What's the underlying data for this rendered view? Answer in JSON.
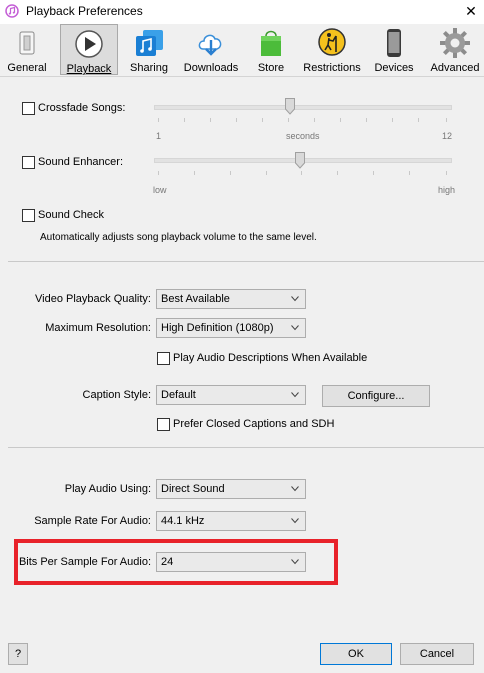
{
  "window": {
    "title": "Playback Preferences",
    "close_glyph": "✕"
  },
  "tabs": [
    {
      "label": "General",
      "icon": "general-switch-icon"
    },
    {
      "label": "Playback",
      "icon": "play-icon",
      "selected": true
    },
    {
      "label": "Sharing",
      "icon": "sharing-music-icon"
    },
    {
      "label": "Downloads",
      "icon": "download-cloud-icon"
    },
    {
      "label": "Store",
      "icon": "store-bag-icon"
    },
    {
      "label": "Restrictions",
      "icon": "restrictions-icon"
    },
    {
      "label": "Devices",
      "icon": "phone-icon"
    },
    {
      "label": "Advanced",
      "icon": "gear-icon"
    }
  ],
  "crossfade": {
    "label": "Crossfade Songs:",
    "checked": false,
    "value": 6,
    "min_label": "1",
    "mid_label": "seconds",
    "max_label": "12"
  },
  "sound_enhancer": {
    "label": "Sound Enhancer:",
    "checked": false,
    "min_label": "low",
    "max_label": "high"
  },
  "sound_check": {
    "label": "Sound Check",
    "checked": false,
    "description": "Automatically adjusts song playback volume to the same level."
  },
  "video_quality": {
    "label": "Video Playback Quality:",
    "value": "Best Available"
  },
  "max_resolution": {
    "label": "Maximum Resolution:",
    "value": "High Definition (1080p)"
  },
  "audio_descriptions": {
    "label": "Play Audio Descriptions When Available",
    "checked": false
  },
  "caption_style": {
    "label": "Caption Style:",
    "value": "Default",
    "configure_label": "Configure..."
  },
  "closed_captions": {
    "label": "Prefer Closed Captions and SDH",
    "checked": false
  },
  "play_audio_using": {
    "label": "Play Audio Using:",
    "value": "Direct Sound"
  },
  "sample_rate": {
    "label": "Sample Rate For Audio:",
    "value": "44.1 kHz"
  },
  "bits_per_sample": {
    "label": "Bits Per Sample For Audio:",
    "value": "24"
  },
  "footer": {
    "help_label": "?",
    "ok_label": "OK",
    "cancel_label": "Cancel"
  },
  "colors": {
    "highlight": "#e8222a",
    "default_button_border": "#0078d7",
    "selected_tab": "#dcdcdc"
  }
}
